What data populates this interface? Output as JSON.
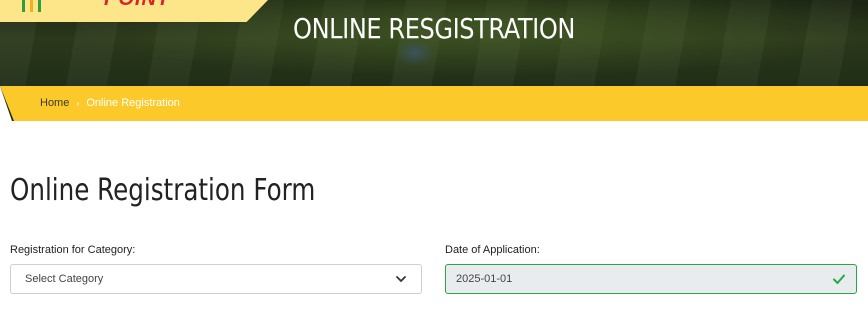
{
  "hero": {
    "title": "ONLINE RESGISTRATION"
  },
  "logo": {
    "text": "POINT"
  },
  "breadcrumb": {
    "home": "Home",
    "separator": "›",
    "current": "Online Registration"
  },
  "form": {
    "title": "Online Registration Form",
    "category": {
      "label": "Registration for Category:",
      "value": "Select Category"
    },
    "date": {
      "label": "Date of Application:",
      "value": "2025-01-01"
    }
  },
  "colors": {
    "accent": "#fcc92b",
    "valid": "#27a745",
    "logo_red": "#d8232a"
  }
}
